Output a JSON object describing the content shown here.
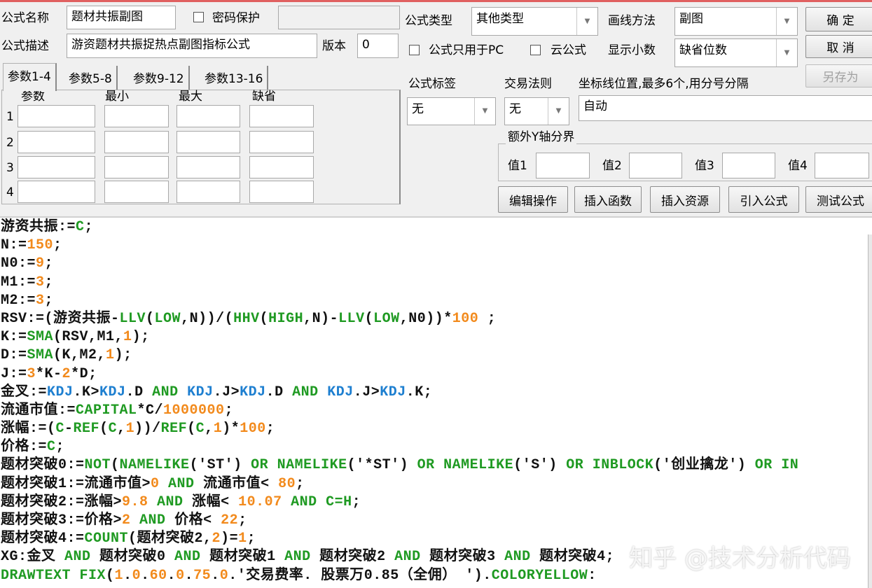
{
  "form": {
    "name_label": "公式名称",
    "name_value": "题材共振副图",
    "password_label": "密码保护",
    "password_value": "",
    "desc_label": "公式描述",
    "desc_value": "游资题材共振捉热点副图指标公式",
    "version_label": "版本",
    "version_value": "0",
    "type_label": "公式类型",
    "type_value": "其他类型",
    "draw_label": "画线方法",
    "draw_value": "副图",
    "pc_only_label": "公式只用于PC",
    "cloud_label": "云公式",
    "decimal_label": "显示小数",
    "decimal_value": "缺省位数",
    "tag_label": "公式标签",
    "tag_value": "无",
    "trade_label": "交易法则",
    "trade_value": "无",
    "axis_label": "坐标线位置,最多6个,用分号分隔",
    "axis_value": "自动",
    "yaxis_group": "额外Y轴分界",
    "values": [
      "值1",
      "值2",
      "值3",
      "值4"
    ]
  },
  "buttons": {
    "ok": "确 定",
    "cancel": "取 消",
    "save_as": "另存为",
    "edit": "编辑操作",
    "insert_func": "插入函数",
    "insert_res": "插入资源",
    "import": "引入公式",
    "test": "测试公式"
  },
  "tabs": [
    "参数1-4",
    "参数5-8",
    "参数9-12",
    "参数13-16"
  ],
  "params": {
    "headers": [
      "参数",
      "最小",
      "最大",
      "缺省"
    ],
    "rows": [
      "1",
      "2",
      "3",
      "4"
    ]
  },
  "editor": {
    "lines": [
      [
        [
          "游资共振:=",
          ""
        ],
        [
          "C",
          "g"
        ],
        [
          ";",
          ""
        ]
      ],
      [
        [
          "N:=",
          ""
        ],
        [
          "150",
          "o"
        ],
        [
          ";",
          ""
        ]
      ],
      [
        [
          "N0:=",
          ""
        ],
        [
          "9",
          "o"
        ],
        [
          ";",
          ""
        ]
      ],
      [
        [
          "M1:=",
          ""
        ],
        [
          "3",
          "o"
        ],
        [
          ";",
          ""
        ]
      ],
      [
        [
          "M2:=",
          ""
        ],
        [
          "3",
          "o"
        ],
        [
          ";",
          ""
        ]
      ],
      [
        [
          "RSV:=(游资共振-",
          ""
        ],
        [
          "LLV",
          "g"
        ],
        [
          "(",
          ""
        ],
        [
          "LOW",
          "g"
        ],
        [
          ",N))/(",
          ""
        ],
        [
          "HHV",
          "g"
        ],
        [
          "(",
          ""
        ],
        [
          "HIGH",
          "g"
        ],
        [
          ",N)-",
          ""
        ],
        [
          "LLV",
          "g"
        ],
        [
          "(",
          ""
        ],
        [
          "LOW",
          "g"
        ],
        [
          ",N0))*",
          ""
        ],
        [
          "100",
          "o"
        ],
        [
          " ;",
          ""
        ]
      ],
      [
        [
          "K:=",
          ""
        ],
        [
          "SMA",
          "g"
        ],
        [
          "(RSV,M1,",
          ""
        ],
        [
          "1",
          "o"
        ],
        [
          ");",
          ""
        ]
      ],
      [
        [
          "D:=",
          ""
        ],
        [
          "SMA",
          "g"
        ],
        [
          "(K,M2,",
          ""
        ],
        [
          "1",
          "o"
        ],
        [
          ");",
          ""
        ]
      ],
      [
        [
          "J:=",
          ""
        ],
        [
          "3",
          "o"
        ],
        [
          "*K-",
          ""
        ],
        [
          "2",
          "o"
        ],
        [
          "*D;",
          ""
        ]
      ],
      [
        [
          "金叉:=",
          ""
        ],
        [
          "KDJ",
          "b"
        ],
        [
          ".K>",
          ""
        ],
        [
          "KDJ",
          "b"
        ],
        [
          ".D ",
          ""
        ],
        [
          "AND",
          "g"
        ],
        [
          " ",
          ""
        ],
        [
          "KDJ",
          "b"
        ],
        [
          ".J>",
          ""
        ],
        [
          "KDJ",
          "b"
        ],
        [
          ".D ",
          ""
        ],
        [
          "AND",
          "g"
        ],
        [
          " ",
          ""
        ],
        [
          "KDJ",
          "b"
        ],
        [
          ".J>",
          ""
        ],
        [
          "KDJ",
          "b"
        ],
        [
          ".K;",
          ""
        ]
      ],
      [
        [
          "流通市值:=",
          ""
        ],
        [
          "CAPITAL",
          "g"
        ],
        [
          "*C/",
          ""
        ],
        [
          "1000000",
          "o"
        ],
        [
          ";",
          ""
        ]
      ],
      [
        [
          "涨幅:=(",
          ""
        ],
        [
          "C",
          "g"
        ],
        [
          "-",
          ""
        ],
        [
          "REF",
          "g"
        ],
        [
          "(",
          ""
        ],
        [
          "C",
          "g"
        ],
        [
          ",",
          ""
        ],
        [
          "1",
          "o"
        ],
        [
          "))/",
          ""
        ],
        [
          "REF",
          "g"
        ],
        [
          "(",
          ""
        ],
        [
          "C",
          "g"
        ],
        [
          ",",
          ""
        ],
        [
          "1",
          "o"
        ],
        [
          ")*",
          ""
        ],
        [
          "100",
          "o"
        ],
        [
          ";",
          ""
        ]
      ],
      [
        [
          "价格:=",
          ""
        ],
        [
          "C",
          "g"
        ],
        [
          ";",
          ""
        ]
      ],
      [
        [
          "题材突破0:=",
          ""
        ],
        [
          "NOT",
          "g"
        ],
        [
          "(",
          ""
        ],
        [
          "NAMELIKE",
          "g"
        ],
        [
          "('ST') ",
          ""
        ],
        [
          "OR",
          "g"
        ],
        [
          " ",
          ""
        ],
        [
          "NAMELIKE",
          "g"
        ],
        [
          "('*ST') ",
          ""
        ],
        [
          "OR",
          "g"
        ],
        [
          " ",
          ""
        ],
        [
          "NAMELIKE",
          "g"
        ],
        [
          "('S') ",
          ""
        ],
        [
          "OR",
          "g"
        ],
        [
          " ",
          ""
        ],
        [
          "INBLOCK",
          "g"
        ],
        [
          "('创业擒龙') ",
          ""
        ],
        [
          "OR",
          "g"
        ],
        [
          " IN",
          "g"
        ]
      ],
      [
        [
          "题材突破1:=流通市值>",
          ""
        ],
        [
          "0",
          "o"
        ],
        [
          " ",
          ""
        ],
        [
          "AND",
          "g"
        ],
        [
          " 流通市值< ",
          ""
        ],
        [
          "80",
          "o"
        ],
        [
          ";",
          ""
        ]
      ],
      [
        [
          "题材突破2:=涨幅>",
          ""
        ],
        [
          "9.8",
          "o"
        ],
        [
          " ",
          ""
        ],
        [
          "AND",
          "g"
        ],
        [
          " 涨幅< ",
          ""
        ],
        [
          "10.07",
          "o"
        ],
        [
          " ",
          ""
        ],
        [
          "AND",
          "g"
        ],
        [
          " ",
          ""
        ],
        [
          "C=H",
          "g"
        ],
        [
          ";",
          ""
        ]
      ],
      [
        [
          "题材突破3:=价格>",
          ""
        ],
        [
          "2",
          "o"
        ],
        [
          " ",
          ""
        ],
        [
          "AND",
          "g"
        ],
        [
          " 价格< ",
          ""
        ],
        [
          "22",
          "o"
        ],
        [
          ";",
          ""
        ]
      ],
      [
        [
          "题材突破4:=",
          ""
        ],
        [
          "COUNT",
          "g"
        ],
        [
          "(题材突破2,",
          ""
        ],
        [
          "2",
          "o"
        ],
        [
          ")=",
          ""
        ],
        [
          "1",
          "o"
        ],
        [
          ";",
          ""
        ]
      ],
      [
        [
          "XG:金叉 ",
          ""
        ],
        [
          "AND",
          "g"
        ],
        [
          " 题材突破0 ",
          ""
        ],
        [
          "AND",
          "g"
        ],
        [
          " 题材突破1 ",
          ""
        ],
        [
          "AND",
          "g"
        ],
        [
          " 题材突破2 ",
          ""
        ],
        [
          "AND",
          "g"
        ],
        [
          " 题材突破3 ",
          ""
        ],
        [
          "AND",
          "g"
        ],
        [
          " 题材突破4;",
          ""
        ]
      ],
      [
        [
          "DRAWTEXT FIX",
          "g"
        ],
        [
          "(",
          ""
        ],
        [
          "1",
          "o"
        ],
        [
          ".",
          ""
        ],
        [
          "0",
          "o"
        ],
        [
          ".",
          ""
        ],
        [
          "60",
          "o"
        ],
        [
          ".",
          ""
        ],
        [
          "0",
          "o"
        ],
        [
          ".",
          ""
        ],
        [
          "75",
          "o"
        ],
        [
          ".",
          ""
        ],
        [
          "0",
          "o"
        ],
        [
          ".'交易费率. 股票万0.85（全佣） ').",
          ""
        ],
        [
          "COLORYELLOW",
          "g"
        ],
        [
          ":",
          ""
        ]
      ]
    ]
  },
  "watermark": "知乎 @技术分析代码"
}
